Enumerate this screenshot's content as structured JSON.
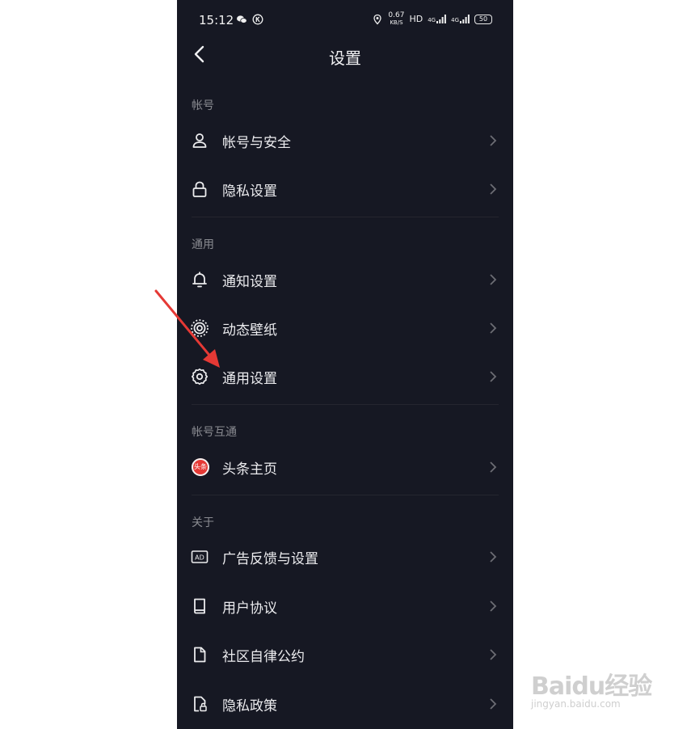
{
  "status_bar": {
    "time": "15:12",
    "network_speed_value": "0.67",
    "network_speed_unit": "KB/S",
    "hd_label": "HD",
    "signal_1": "4G",
    "signal_2": "4G",
    "battery_level": "50"
  },
  "header": {
    "title": "设置"
  },
  "sections": [
    {
      "title": "帐号",
      "items": [
        {
          "label": "帐号与安全",
          "icon": "user-icon"
        },
        {
          "label": "隐私设置",
          "icon": "lock-icon"
        }
      ]
    },
    {
      "title": "通用",
      "items": [
        {
          "label": "通知设置",
          "icon": "bell-icon"
        },
        {
          "label": "动态壁纸",
          "icon": "live-wallpaper-icon"
        },
        {
          "label": "通用设置",
          "icon": "gear-icon"
        }
      ]
    },
    {
      "title": "帐号互通",
      "items": [
        {
          "label": "头条主页",
          "icon": "toutiao-logo",
          "badge": "头条"
        }
      ]
    },
    {
      "title": "关于",
      "items": [
        {
          "label": "广告反馈与设置",
          "icon": "ad-icon"
        },
        {
          "label": "用户协议",
          "icon": "book-icon"
        },
        {
          "label": "社区自律公约",
          "icon": "document-icon"
        },
        {
          "label": "隐私政策",
          "icon": "privacy-document-icon"
        }
      ]
    }
  ],
  "annotation": {
    "color": "#e53935"
  },
  "watermark": {
    "brand": "Baidu经验",
    "url": "jingyan.baidu.com"
  },
  "colors": {
    "background": "#161823",
    "text": "#ebebee",
    "section_header": "#8a8b91",
    "divider": "#25262f"
  }
}
